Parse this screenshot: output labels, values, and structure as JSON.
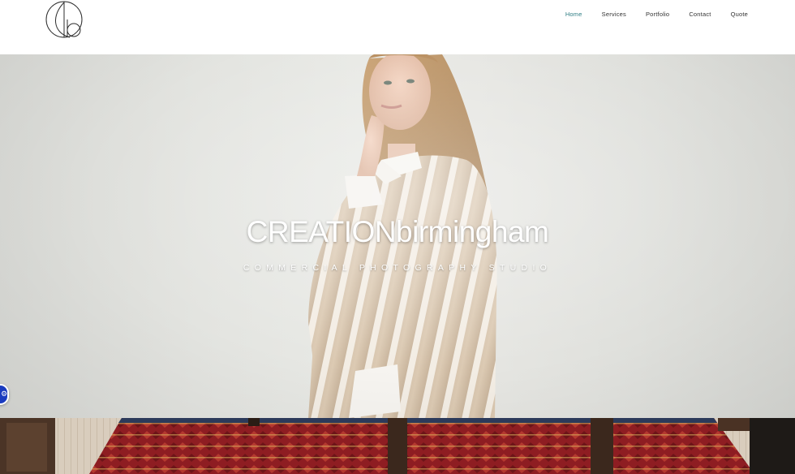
{
  "header": {
    "logo_name": "cb-monogram-logo",
    "nav": [
      {
        "label": "Home",
        "active": true
      },
      {
        "label": "Services",
        "active": false
      },
      {
        "label": "Portfolio",
        "active": false
      },
      {
        "label": "Contact",
        "active": false
      },
      {
        "label": "Quote",
        "active": false
      }
    ]
  },
  "hero": {
    "title": "CREATIONbirmingham",
    "subtitle": "COMMERCIAL PHOTOGRAPHY STUDIO"
  },
  "accessibility": {
    "icon": "accessibility-icon"
  },
  "colors": {
    "nav_active": "#2f7d84",
    "nav_text": "#333333",
    "hero_bg": "#e4e5e1",
    "a11y": "#1a3bbf",
    "rug_red": "#8e1d22"
  }
}
